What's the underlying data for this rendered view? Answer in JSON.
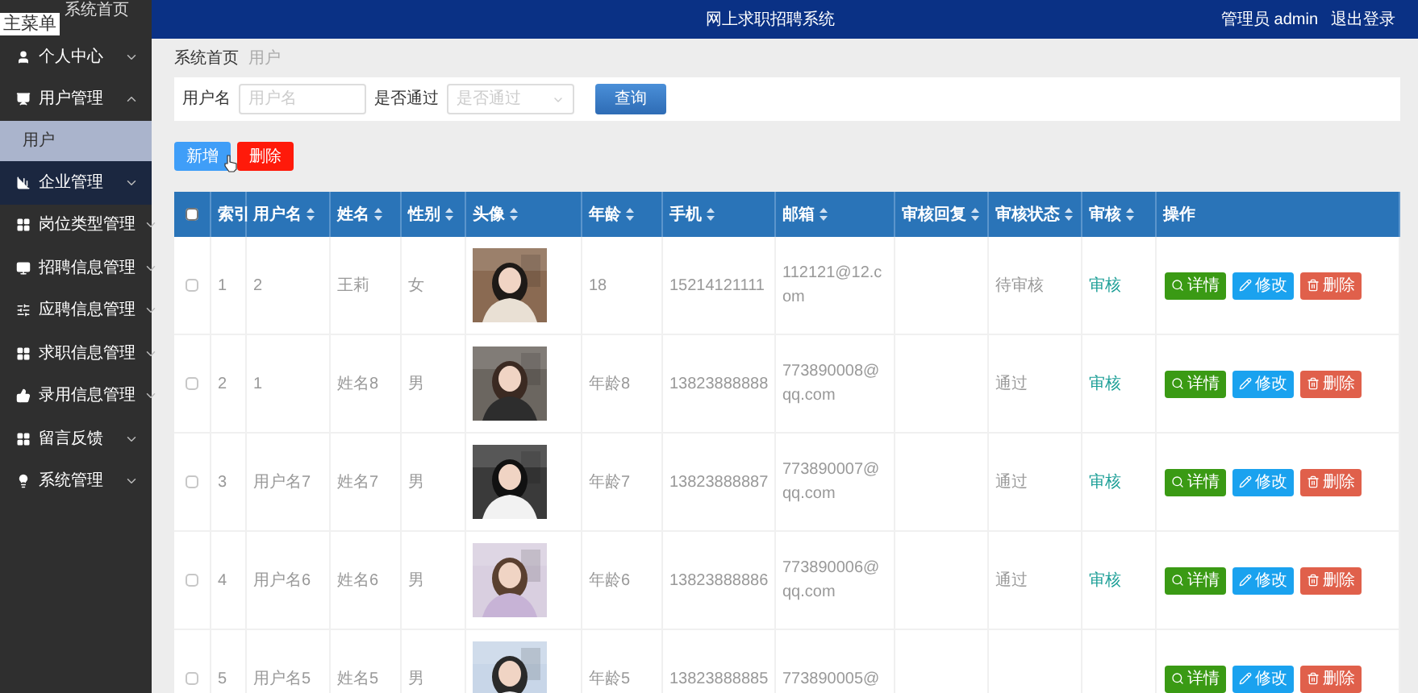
{
  "overlay_label": "主菜单",
  "sidebar": {
    "home": "系统首页",
    "items": [
      {
        "label": "个人中心",
        "expanded": false,
        "hovered": false
      },
      {
        "label": "用户管理",
        "expanded": true,
        "hovered": false,
        "children": [
          {
            "label": "用户",
            "selected": true
          }
        ]
      },
      {
        "label": "企业管理",
        "expanded": false,
        "hovered": true
      },
      {
        "label": "岗位类型管理",
        "expanded": false,
        "hovered": false
      },
      {
        "label": "招聘信息管理",
        "expanded": false,
        "hovered": false
      },
      {
        "label": "应聘信息管理",
        "expanded": false,
        "hovered": false
      },
      {
        "label": "求职信息管理",
        "expanded": false,
        "hovered": false
      },
      {
        "label": "录用信息管理",
        "expanded": false,
        "hovered": false
      },
      {
        "label": "留言反馈",
        "expanded": false,
        "hovered": false
      },
      {
        "label": "系统管理",
        "expanded": false,
        "hovered": false
      }
    ]
  },
  "header": {
    "title": "网上求职招聘系统",
    "user": "管理员 admin",
    "logout": "退出登录"
  },
  "breadcrumb": [
    "系统首页",
    "用户"
  ],
  "search": {
    "fields": [
      {
        "label": "用户名",
        "placeholder": "用户名",
        "kind": "text"
      },
      {
        "label": "是否通过",
        "placeholder": "是否通过",
        "kind": "select"
      }
    ],
    "button": "查询"
  },
  "actions": [
    {
      "label": "新增",
      "kind": "add"
    },
    {
      "label": "删除",
      "kind": "delete"
    }
  ],
  "table": {
    "select_all": {
      "checked": false
    },
    "columns": [
      {
        "label": "索引",
        "sortable": false
      },
      {
        "label": "用户名",
        "sortable": true
      },
      {
        "label": "姓名",
        "sortable": true
      },
      {
        "label": "性别",
        "sortable": true
      },
      {
        "label": "头像",
        "sortable": true
      },
      {
        "label": "年龄",
        "sortable": true
      },
      {
        "label": "手机",
        "sortable": true
      },
      {
        "label": "邮箱",
        "sortable": true
      },
      {
        "label": "审核回复",
        "sortable": true
      },
      {
        "label": "审核状态",
        "sortable": true
      },
      {
        "label": "审核",
        "sortable": true
      },
      {
        "label": "操作",
        "sortable": false
      }
    ],
    "rows": [
      {
        "checked": false,
        "index": "1",
        "username": "2",
        "name": "王莉",
        "sex": "女",
        "age": "18",
        "phone": "15214121111",
        "email": "112121@12.com",
        "status": "待审核",
        "review": "审核",
        "buttons": [
          "详情",
          "修改",
          "删除"
        ]
      },
      {
        "checked": false,
        "index": "2",
        "username": "1",
        "name": "姓名8",
        "sex": "男",
        "age": "年龄8",
        "phone": "13823888888",
        "email": "773890008@qq.com",
        "status": "通过",
        "review": "审核",
        "buttons": [
          "详情",
          "修改",
          "删除"
        ]
      },
      {
        "checked": false,
        "index": "3",
        "username": "用户名7",
        "name": "姓名7",
        "sex": "男",
        "age": "年龄7",
        "phone": "13823888887",
        "email": "773890007@qq.com",
        "status": "通过",
        "review": "审核",
        "buttons": [
          "详情",
          "修改",
          "删除"
        ]
      },
      {
        "checked": false,
        "index": "4",
        "username": "用户名6",
        "name": "姓名6",
        "sex": "男",
        "age": "年龄6",
        "phone": "13823888886",
        "email": "773890006@qq.com",
        "status": "通过",
        "review": "审核",
        "buttons": [
          "详情",
          "修改",
          "删除"
        ]
      },
      {
        "checked": false,
        "index": "5",
        "username": "用户名5",
        "name": "姓名5",
        "sex": "男",
        "age": "年龄5",
        "phone": "13823888885",
        "email": "773890005@",
        "buttons": [
          "详情",
          "修改",
          "删除"
        ]
      }
    ]
  }
}
